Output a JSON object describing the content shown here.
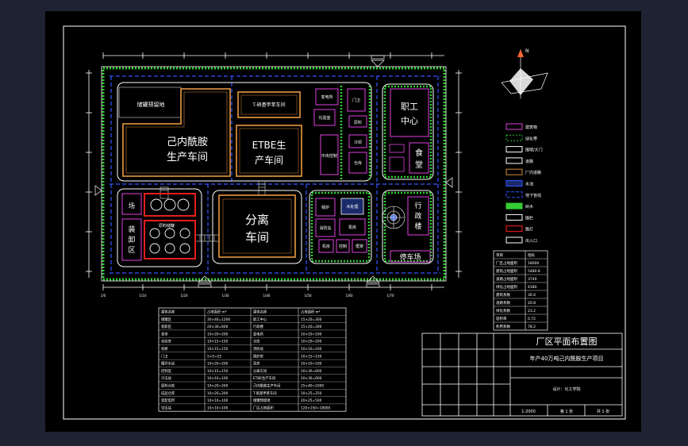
{
  "plan": {
    "buildings": {
      "storage": "储罐预留地",
      "caprolactam": "己内酰胺\n生产车间",
      "etbe": "ETBE生\n产车间",
      "small_top": "T-硝基甲苯车间",
      "separation": "分离\n车间",
      "staff_center": "职工\n中心",
      "canteen": "食\n堂",
      "admin": "行\n政\n楼",
      "parking": "停车场",
      "unload": "装\n卸\n区",
      "field": "场",
      "tank_label": "原料储罐",
      "toilet": "厕所",
      "sub1": "变电所",
      "sub2": "仓库",
      "sub3": "机修",
      "lab": "化验室",
      "boiler": "锅炉",
      "fire": "消防站",
      "ware": "仓库",
      "control": "中央控制",
      "pump": "泵房",
      "office": "办\n公",
      "gate": "门卫",
      "store_r": "原料",
      "water": "水处理",
      "cooling": "冷却",
      "room": "机房",
      "ctrl2": "控制",
      "frame": "框架"
    },
    "compass": "N",
    "ticks_x": [
      "1/0",
      "1/10",
      "1/20",
      "1/30",
      "1/40",
      "1/50",
      "1/60",
      "1/70"
    ]
  },
  "legend": {
    "items": [
      {
        "label": "建筑物"
      },
      {
        "label": "绿化带"
      },
      {
        "label": "围墙/大门"
      },
      {
        "label": "道路"
      },
      {
        "label": "厂内道路"
      },
      {
        "label": "水池"
      },
      {
        "label": "地下管线"
      },
      {
        "label": "树木"
      },
      {
        "label": "围栏"
      },
      {
        "label": "路灯"
      },
      {
        "label": "出入口"
      }
    ]
  },
  "right_table": {
    "header": [
      "项目",
      "指标"
    ],
    "rows": [
      [
        "厂区占地面积",
        "18000"
      ],
      [
        "建筑占地面积",
        "5480.8"
      ],
      [
        "道路占地面积",
        "3740"
      ],
      [
        "绿化占地面积",
        "4180"
      ],
      [
        "建筑系数",
        "30.4"
      ],
      [
        "道路系数",
        "20.8"
      ],
      [
        "绿化系数",
        "23.2"
      ],
      [
        "容积率",
        "0.72"
      ],
      [
        "利用系数",
        "78.2"
      ]
    ]
  },
  "bottom_table": {
    "header": [
      "建筑名称",
      "占地面积 m²",
      "建筑名称",
      "占地面积 m²"
    ],
    "rows": [
      [
        "储罐区",
        "30×40=1200",
        "职工中心",
        "15×20=300"
      ],
      [
        "装卸区",
        "20×30=600",
        "行政楼",
        "15×20=300"
      ],
      [
        "食堂",
        "10×20=200",
        "变电所",
        "10×10=100"
      ],
      [
        "化验室",
        "10×15=150",
        "仓库",
        "10×20=200"
      ],
      [
        "机修",
        "10×15=150",
        "消防站",
        "10×10=100"
      ],
      [
        "门卫",
        "5×5=25",
        "锅炉房",
        "10×15=150"
      ],
      [
        "循环水站",
        "10×20=200",
        "泵房",
        "10×10=100"
      ],
      [
        "控制室",
        "10×15=150",
        "分离车间",
        "20×30=600"
      ],
      [
        "冷冻站",
        "10×10=100",
        "ETBE生产车间",
        "20×30=600"
      ],
      [
        "原料仓库",
        "10×20=200",
        "己内酰胺生产车间",
        "25×40=1000"
      ],
      [
        "成品仓库",
        "10×20=200",
        "T-硝基甲苯车间",
        "10×25=250"
      ],
      [
        "变配电所",
        "10×10=100",
        "储罐预留地",
        "20×25=500"
      ],
      [
        "空压站",
        "10×10=100",
        "厂区占地面积",
        "120×150=18000"
      ]
    ]
  },
  "title_block": {
    "title": "厂区平面布置图",
    "project": "年产40万吨己内酰胺生产项目",
    "designer": "设计：化工学院",
    "scale": "1:2000",
    "sheet": "第 1 张",
    "total": "共 1 张"
  }
}
